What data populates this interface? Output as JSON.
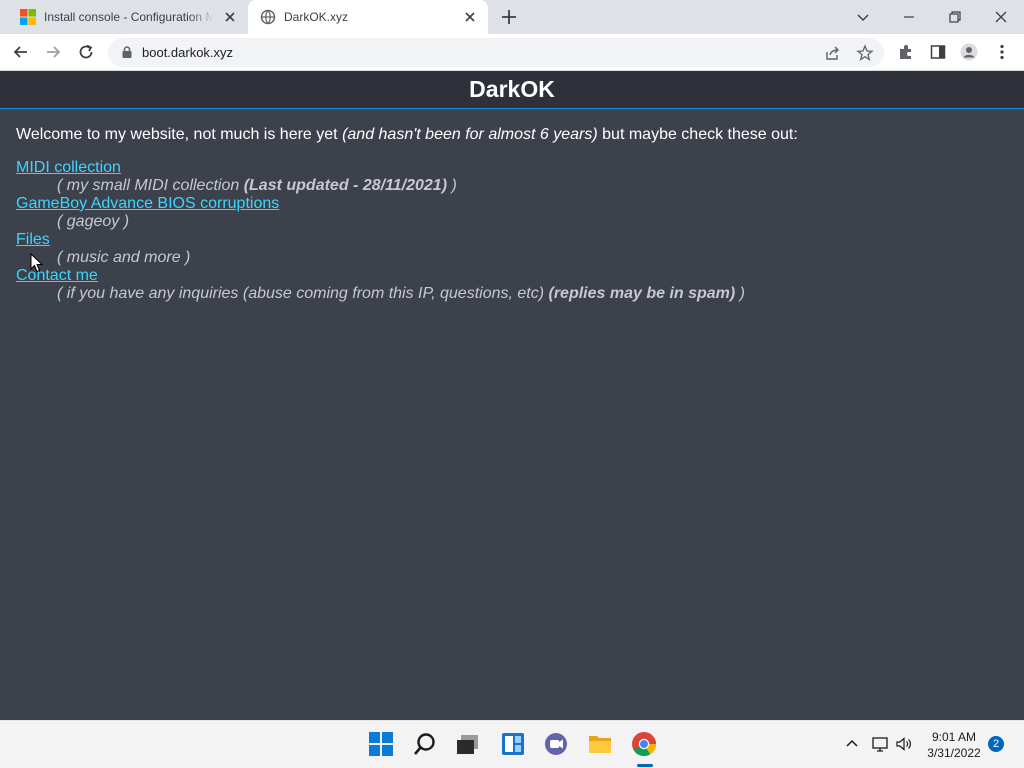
{
  "browser": {
    "tabs": [
      {
        "title": "Install console - Configuration M",
        "active": false,
        "favicon": "microsoft-logo"
      },
      {
        "title": "DarkOK.xyz",
        "active": true,
        "favicon": "globe-icon"
      }
    ],
    "address": "boot.darkok.xyz"
  },
  "site": {
    "title": "DarkOK",
    "intro": {
      "before": "Welcome to my website, not much is here yet ",
      "italic": "(and hasn't been for almost 6 years)",
      "after": " but maybe check these out:"
    },
    "links": [
      {
        "label": "MIDI collection",
        "desc_before": "( my small MIDI collection ",
        "desc_bold": "(Last updated - 28/11/2021)",
        "desc_after": " )"
      },
      {
        "label": "GameBoy Advance BIOS corruptions",
        "desc_before": "( gageoy )",
        "desc_bold": "",
        "desc_after": ""
      },
      {
        "label": "Files",
        "desc_before": "( music and more )",
        "desc_bold": "",
        "desc_after": ""
      },
      {
        "label": "Contact me",
        "desc_before": "( if you have any inquiries (abuse coming from this IP, questions, etc) ",
        "desc_bold": "(replies may be in spam)",
        "desc_after": " )"
      }
    ]
  },
  "taskbar": {
    "apps": [
      "start-icon",
      "search-icon",
      "task-view-icon",
      "widgets-icon",
      "chat-icon",
      "file-explorer-icon",
      "chrome-icon"
    ],
    "clock": {
      "time": "9:01 AM",
      "date": "3/31/2022"
    },
    "notifications": "2"
  },
  "colors": {
    "page_bg": "#3d414b",
    "header_bg": "#2e313a",
    "link": "#3ad6ff",
    "accent": "#1a8fcf"
  }
}
